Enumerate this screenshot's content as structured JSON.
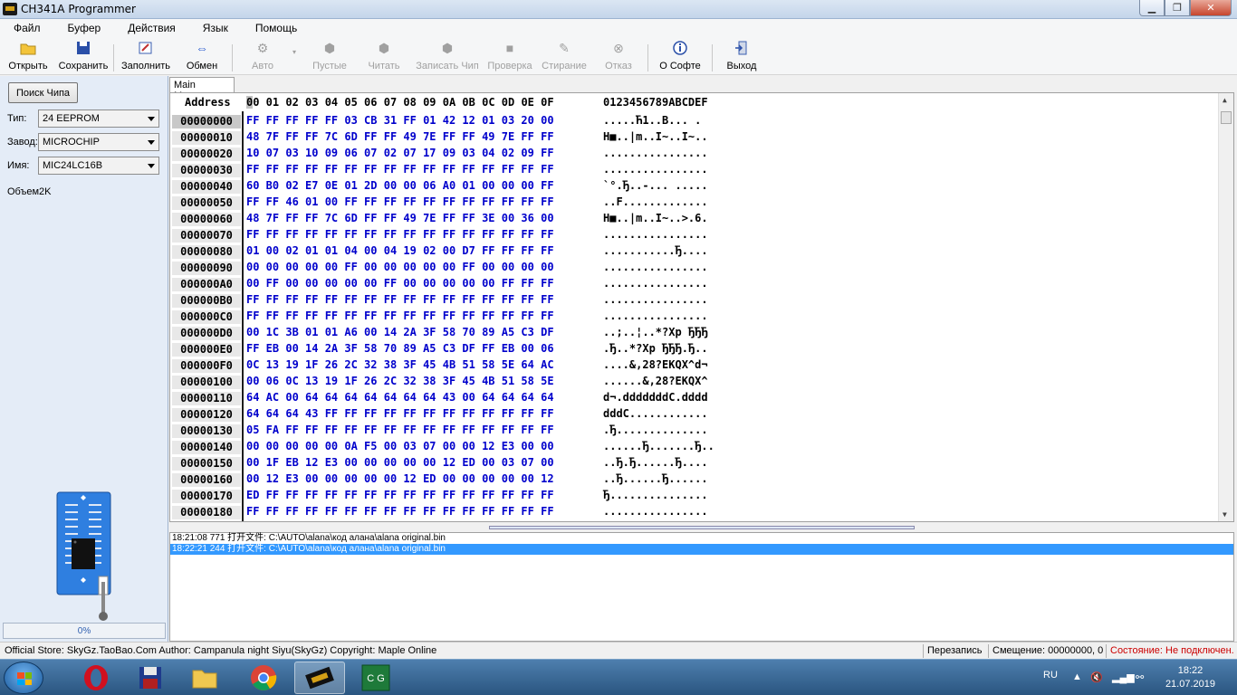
{
  "window": {
    "title": "CH341A Programmer"
  },
  "menu": [
    "Файл",
    "Буфер",
    "Действия",
    "Язык",
    "Помощь"
  ],
  "toolbar": {
    "open": "Открыть",
    "save": "Сохранить",
    "fill": "Заполнить",
    "exchange": "Обмен",
    "auto": "Авто",
    "blank": "Пустые",
    "read": "Читать",
    "write": "Записать Чип",
    "verify": "Проверка",
    "erase": "Стирание",
    "cancel": "Отказ",
    "about": "О Софте",
    "exit": "Выход"
  },
  "left_panel": {
    "search_button": "Поиск Чипа",
    "type_label": "Тип:",
    "type_value": "24 EEPROM",
    "maker_label": "Завод:",
    "maker_value": "MICROCHIP",
    "name_label": "Имя:",
    "name_value": "MIC24LC16B",
    "volume": "Объем2K",
    "progress": "0%",
    "progress_fraction": 0
  },
  "hex": {
    "tab": "Main Memory",
    "header_addr": "Address",
    "header_first": "0",
    "header_cols": "0 01 02 03 04 05 06 07 08 09 0A 0B 0C 0D 0E 0F",
    "header_ascii": "0123456789ABCDEF",
    "rows": [
      {
        "addr": "00000000",
        "bytes": "FF FF FF FF FF 03 CB 31 FF 01 42 12 01 03 20 00",
        "ascii": ".....Ћ1..B... ."
      },
      {
        "addr": "00000010",
        "bytes": "48 7F FF FF 7C 6D FF FF 49 7E FF FF 49 7E FF FF",
        "ascii": "H■..|m..I~..I~.."
      },
      {
        "addr": "00000020",
        "bytes": "10 07 03 10 09 06 07 02 07 17 09 03 04 02 09 FF",
        "ascii": "................"
      },
      {
        "addr": "00000030",
        "bytes": "FF FF FF FF FF FF FF FF FF FF FF FF FF FF FF FF",
        "ascii": "................"
      },
      {
        "addr": "00000040",
        "bytes": "60 B0 02 E7 0E 01 2D 00 00 06 A0 01 00 00 00 FF",
        "ascii": "`°.Ђ..-... ....."
      },
      {
        "addr": "00000050",
        "bytes": "FF FF 46 01 00 FF FF FF FF FF FF FF FF FF FF FF",
        "ascii": "..F............."
      },
      {
        "addr": "00000060",
        "bytes": "48 7F FF FF 7C 6D FF FF 49 7E FF FF 3E 00 36 00",
        "ascii": "H■..|m..I~..>.6."
      },
      {
        "addr": "00000070",
        "bytes": "FF FF FF FF FF FF FF FF FF FF FF FF FF FF FF FF",
        "ascii": "................"
      },
      {
        "addr": "00000080",
        "bytes": "01 00 02 01 01 04 00 04 19 02 00 D7 FF FF FF FF",
        "ascii": "...........Ђ...."
      },
      {
        "addr": "00000090",
        "bytes": "00 00 00 00 00 FF 00 00 00 00 00 FF 00 00 00 00",
        "ascii": "................"
      },
      {
        "addr": "000000A0",
        "bytes": "00 FF 00 00 00 00 00 FF 00 00 00 00 00 FF FF FF",
        "ascii": "................"
      },
      {
        "addr": "000000B0",
        "bytes": "FF FF FF FF FF FF FF FF FF FF FF FF FF FF FF FF",
        "ascii": "................"
      },
      {
        "addr": "000000C0",
        "bytes": "FF FF FF FF FF FF FF FF FF FF FF FF FF FF FF FF",
        "ascii": "................"
      },
      {
        "addr": "000000D0",
        "bytes": "00 1C 3B 01 01 A6 00 14 2A 3F 58 70 89 A5 C3 DF",
        "ascii": "..;..¦..*?Xp ЂЂЂ"
      },
      {
        "addr": "000000E0",
        "bytes": "FF EB 00 14 2A 3F 58 70 89 A5 C3 DF FF EB 00 06",
        "ascii": ".Ђ..*?Xp ЂЂЂ.Ђ.."
      },
      {
        "addr": "000000F0",
        "bytes": "0C 13 19 1F 26 2C 32 38 3F 45 4B 51 58 5E 64 AC",
        "ascii": "....&,28?EKQX^d¬"
      },
      {
        "addr": "00000100",
        "bytes": "00 06 0C 13 19 1F 26 2C 32 38 3F 45 4B 51 58 5E",
        "ascii": "......&,28?EKQX^"
      },
      {
        "addr": "00000110",
        "bytes": "64 AC 00 64 64 64 64 64 64 64 43 00 64 64 64 64",
        "ascii": "d¬.dddddddC.dddd"
      },
      {
        "addr": "00000120",
        "bytes": "64 64 64 43 FF FF FF FF FF FF FF FF FF FF FF FF",
        "ascii": "dddC............"
      },
      {
        "addr": "00000130",
        "bytes": "05 FA FF FF FF FF FF FF FF FF FF FF FF FF FF FF",
        "ascii": ".Ђ.............."
      },
      {
        "addr": "00000140",
        "bytes": "00 00 00 00 00 0A F5 00 03 07 00 00 12 E3 00 00",
        "ascii": "......Ђ.......Ђ.."
      },
      {
        "addr": "00000150",
        "bytes": "00 1F EB 12 E3 00 00 00 00 00 12 ED 00 03 07 00",
        "ascii": "..Ђ.Ђ......Ђ...."
      },
      {
        "addr": "00000160",
        "bytes": "00 12 E3 00 00 00 00 00 12 ED 00 00 00 00 00 12",
        "ascii": "..Ђ......Ђ......"
      },
      {
        "addr": "00000170",
        "bytes": "ED FF FF FF FF FF FF FF FF FF FF FF FF FF FF FF",
        "ascii": "Ђ..............."
      },
      {
        "addr": "00000180",
        "bytes": "FF FF FF FF FF FF FF FF FF FF FF FF FF FF FF FF",
        "ascii": "................"
      }
    ]
  },
  "log": [
    {
      "text": "18:21:08 771 打开文件: C:\\AUTO\\alana\\код алана\\alana original.bin",
      "selected": false
    },
    {
      "text": "18:22:21 244 打开文件: C:\\AUTO\\alana\\код алана\\alana original.bin",
      "selected": true
    }
  ],
  "status": {
    "info": "Official Store: SkyGz.TaoBao.Com Author: Campanula night Siyu(SkyGz) Copyright: Maple Online",
    "mode": "Перезапись",
    "offset": "Смещение: 00000000, 0",
    "state": "Состояние: Не подключен.",
    "state_color": "#cc0000"
  },
  "taskbar": {
    "lang": "RU",
    "time": "18:22",
    "date": "21.07.2019",
    "apps": [
      "opera-icon",
      "save-icon",
      "explorer-icon",
      "chrome-icon",
      "ch341a-icon",
      "cg-icon"
    ]
  }
}
